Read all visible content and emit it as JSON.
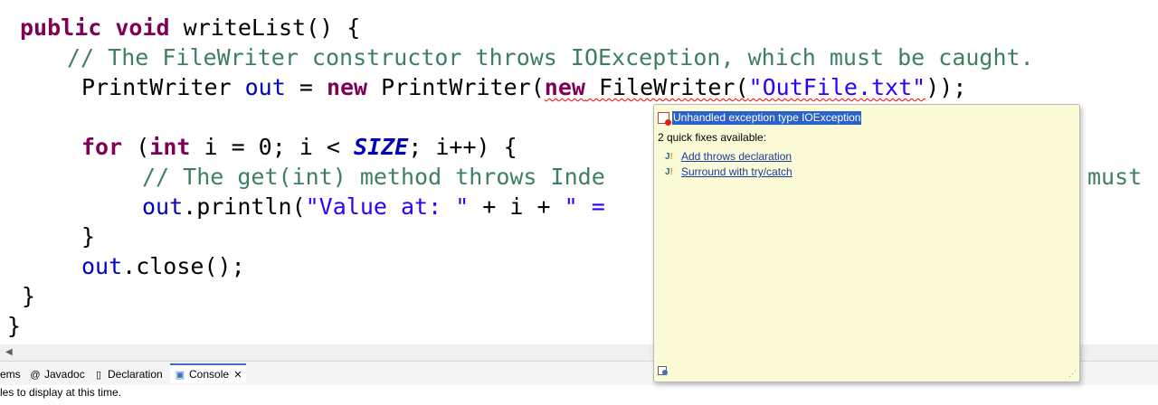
{
  "editor": {
    "code": {
      "l1": {
        "k1": "public",
        "k2": "void",
        "rest": " writeList() {"
      },
      "l2": {
        "comment": "// The FileWriter constructor throws IOException, which must be caught."
      },
      "l3": {
        "a": "PrintWriter ",
        "out": "out",
        "b": " = ",
        "k1": "new",
        "c": " PrintWriter(",
        "k2": "new",
        "d": " FileWriter(",
        "s": "\"OutFile.txt\"",
        "e": "));"
      },
      "l5": {
        "k1": "for",
        "a": " (",
        "k2": "int",
        "b": " i = 0; i < ",
        "size": "SIZE",
        "c": "; i++) {"
      },
      "l6": {
        "comment": "// The get(int) method throws Inde",
        "tail": "must"
      },
      "l7": {
        "out": "out",
        "a": ".println(",
        "s1": "\"Value at: \"",
        "b": " + i + ",
        "s2": "\" ="
      },
      "l8": {
        "a": "}"
      },
      "l9": {
        "out": "out",
        "a": ".close();"
      },
      "l10": {
        "a": "}"
      },
      "l11": {
        "a": "}"
      }
    }
  },
  "hover": {
    "title": "Unhandled exception type IOException",
    "fix_count": "2 quick fixes available:",
    "fixes": [
      {
        "label": "Add throws declaration"
      },
      {
        "label": "Surround with try/catch"
      }
    ]
  },
  "bottom_tabs": {
    "problems": "ems",
    "javadoc": "Javadoc",
    "declaration": "Declaration",
    "console": "Console",
    "close_glyph": "✕"
  },
  "console_status": "les to display at this time.",
  "colors": {
    "keyword": "#7f0055",
    "comment": "#3f7f5f",
    "string": "#2a00ff",
    "field": "#0000c0",
    "hover_bg": "#fbfbd8",
    "selection": "#2a62c8"
  }
}
